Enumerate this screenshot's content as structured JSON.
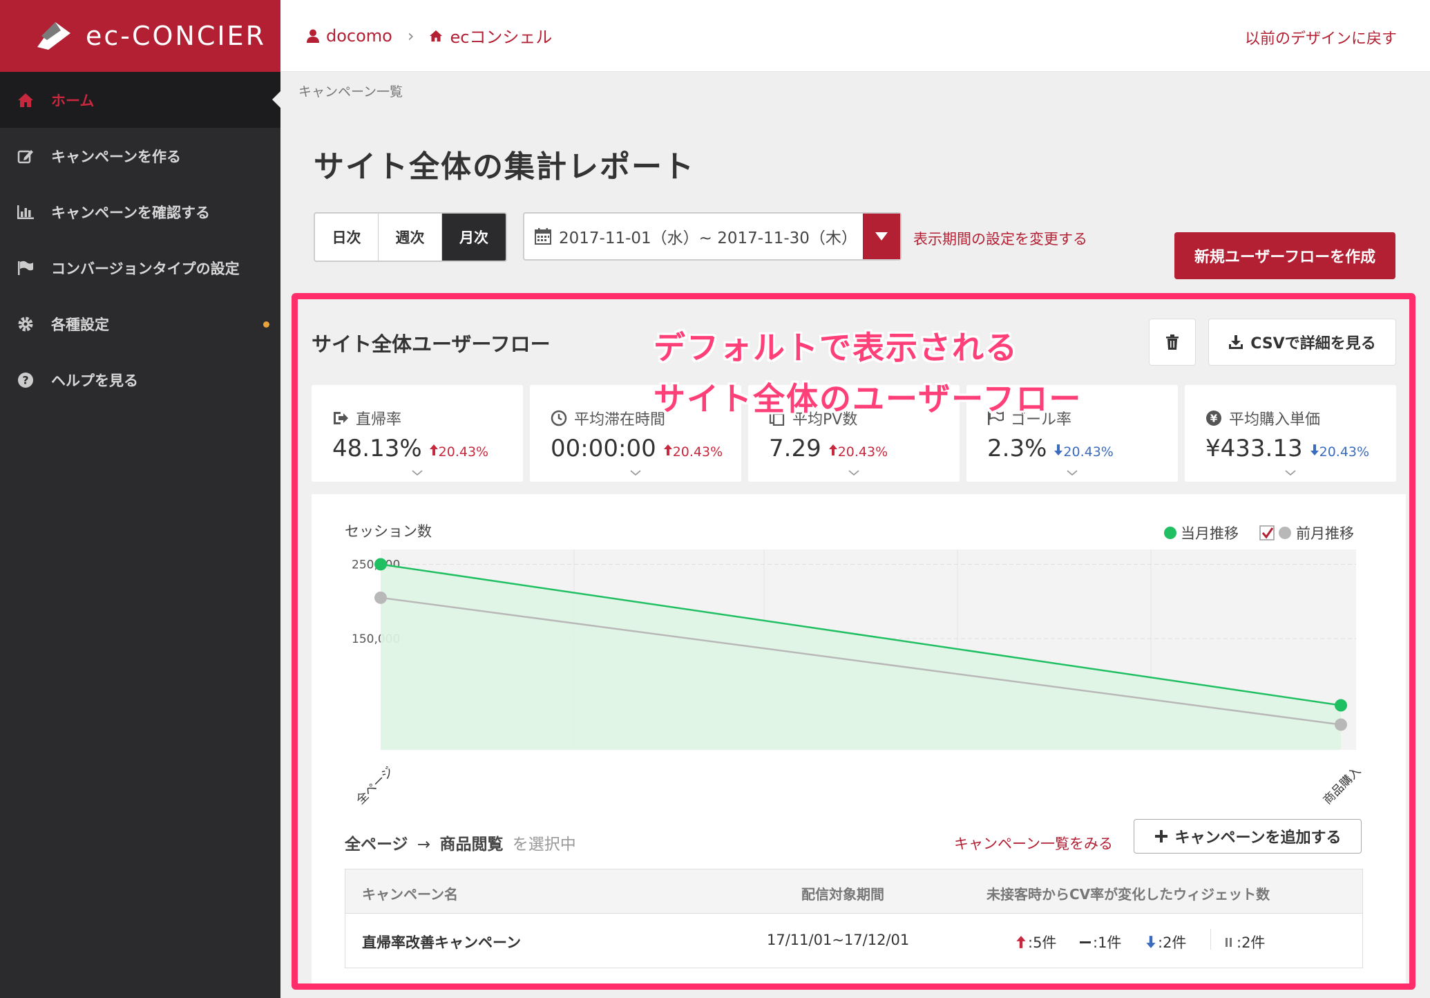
{
  "app": {
    "logo_text": "ec-CONCIER"
  },
  "sidebar": {
    "items": [
      {
        "label": "ホーム",
        "icon": "home-icon"
      },
      {
        "label": "キャンペーンを作る",
        "icon": "edit-icon"
      },
      {
        "label": "キャンペーンを確認する",
        "icon": "bar-chart-icon"
      },
      {
        "label": "コンバージョンタイプの設定",
        "icon": "flag-icon"
      },
      {
        "label": "各種設定",
        "icon": "gear-icon"
      },
      {
        "label": "ヘルプを見る",
        "icon": "question-icon"
      }
    ]
  },
  "topbar": {
    "crumb1": "docomo",
    "crumb_sep": "›",
    "crumb2": "ecコンシェル",
    "revert_link": "以前のデザインに戻す"
  },
  "breadcrumb": "キャンペーン一覧",
  "page_title": "サイト全体の集計レポート",
  "period_tabs": [
    "日次",
    "週次",
    "月次"
  ],
  "date_range": "2017-11-01（水）~ 2017-11-30（木）",
  "change_period_link": "表示期間の設定を変更する",
  "new_flow_button": "新規ユーザーフローを作成",
  "panel": {
    "title": "サイト全体ユーザーフロー",
    "csv_button": "CSVで詳細を見る",
    "overlay_line1": "デフォルトで表示される",
    "overlay_line2": "サイト全体のユーザーフロー"
  },
  "metrics": [
    {
      "label": "直帰率",
      "value": "48.13%",
      "change": "20.43%",
      "direction": "up",
      "icon": "exit-icon"
    },
    {
      "label": "平均滞在時間",
      "value": "00:00:00",
      "change": "20.43%",
      "direction": "up",
      "icon": "clock-icon"
    },
    {
      "label": "平均PV数",
      "value": "7.29",
      "change": "20.43%",
      "direction": "up",
      "icon": "pages-icon"
    },
    {
      "label": "ゴール率",
      "value": "2.3%",
      "change": "20.43%",
      "direction": "down",
      "icon": "flag-icon"
    },
    {
      "label": "平均購入単価",
      "value": "¥433.13",
      "change": "20.43%",
      "direction": "down",
      "icon": "yen-icon"
    }
  ],
  "chart_data": {
    "type": "line",
    "ylabel": "セッション数",
    "categories": [
      "全ページ",
      "商品購入"
    ],
    "series": [
      {
        "name": "当月推移",
        "values": [
          250000,
          60000
        ],
        "color": "#1fbf62"
      },
      {
        "name": "前月推移",
        "values": [
          205000,
          34000
        ],
        "color": "#b8b8b8"
      }
    ],
    "yticks": [
      "250,000",
      "150,000"
    ],
    "ytick_values": [
      250000,
      150000
    ],
    "ylim": [
      0,
      270000
    ],
    "legend_placement": "top-right",
    "prev_month_checked": true
  },
  "selection": {
    "from": "全ページ",
    "arrow": "→",
    "to": "商品閲覧",
    "suffix": "を選択中",
    "campaign_list_link": "キャンペーン一覧をみる",
    "add_campaign_button": "キャンペーンを追加する"
  },
  "table": {
    "headers": [
      "キャンペーン名",
      "配信対象期間",
      "未接客時からCV率が変化したウィジェット数"
    ],
    "rows": [
      {
        "name": "直帰率改善キャンペーン",
        "period": "17/11/01~17/12/01",
        "up": ":5件",
        "flat": ":1件",
        "down": ":2件",
        "pause": ":2件"
      }
    ]
  },
  "colors": {
    "brand": "#b31f33",
    "sidebar": "#2b2b2e",
    "highlight": "#ff2d6a",
    "up": "#c8283d",
    "down": "#3a6bbf"
  }
}
